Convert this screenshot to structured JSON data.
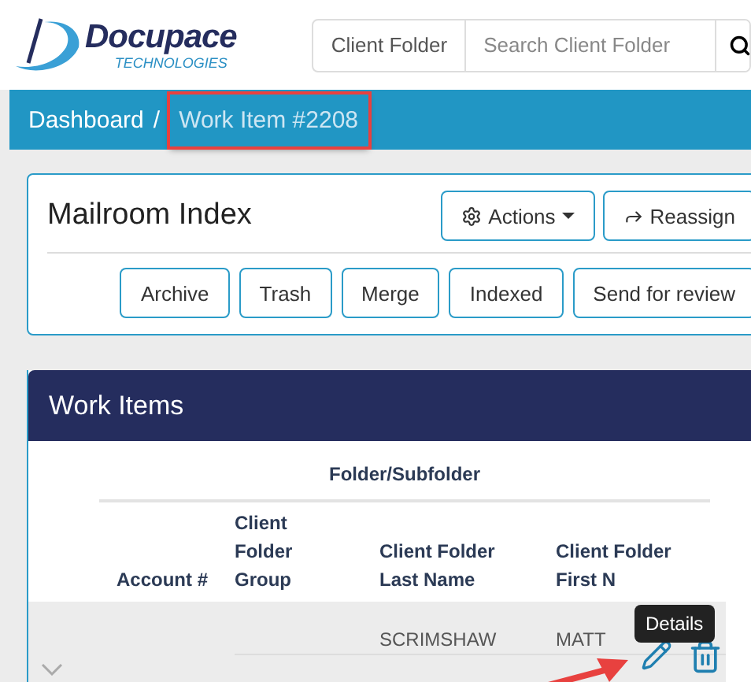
{
  "header": {
    "logo": {
      "name": "Docupace",
      "tagline": "TECHNOLOGIES"
    },
    "search": {
      "scope": "Client Folder",
      "placeholder": "Search Client Folder"
    }
  },
  "breadcrumb": {
    "items": [
      {
        "label": "Dashboard",
        "highlighted": false
      },
      {
        "label": "Work Item #2208",
        "highlighted": true
      }
    ],
    "separator": "/"
  },
  "mailroom": {
    "title": "Mailroom Index",
    "actions": [
      {
        "label": "Actions",
        "kind": "dropdown"
      },
      {
        "label": "Reassign",
        "kind": "share"
      }
    ],
    "buttons": [
      "Archive",
      "Trash",
      "Merge",
      "Indexed",
      "Send for review"
    ]
  },
  "work_items": {
    "title": "Work Items",
    "group_header": "Folder/Subfolder",
    "columns": [
      "Account #",
      "Client Folder Group",
      "Client Folder Last Name",
      "Client Folder First N"
    ],
    "rows": [
      {
        "cells": [
          "",
          "",
          "SCRIMSHAW",
          "MATT"
        ],
        "expanded": false
      }
    ],
    "tooltip": "Details"
  }
}
